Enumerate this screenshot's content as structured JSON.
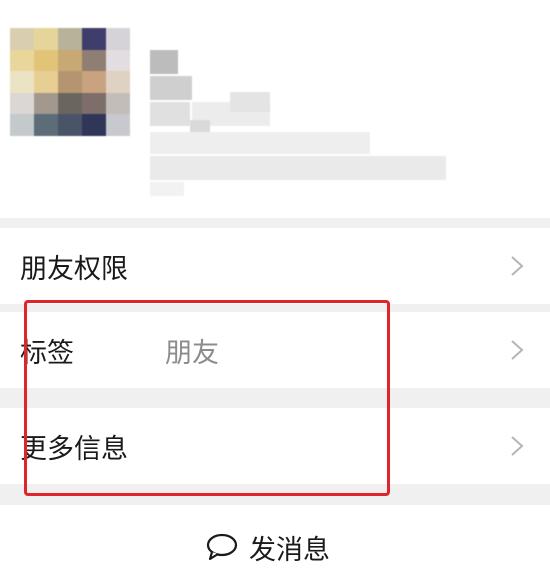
{
  "profile": {
    "avatar_label": "avatar (pixelated)",
    "name_label": "name (pixelated)"
  },
  "rows": [
    {
      "label": "朋友权限",
      "value": ""
    },
    {
      "label": "标签",
      "value": "朋友"
    },
    {
      "label": "更多信息",
      "value": ""
    }
  ],
  "send_message": {
    "label": "发消息",
    "icon": "chat-bubble-icon"
  },
  "colors": {
    "highlight": "#e0242b",
    "secondary_text": "#8c8c8c",
    "separator": "#f0f0f0"
  }
}
